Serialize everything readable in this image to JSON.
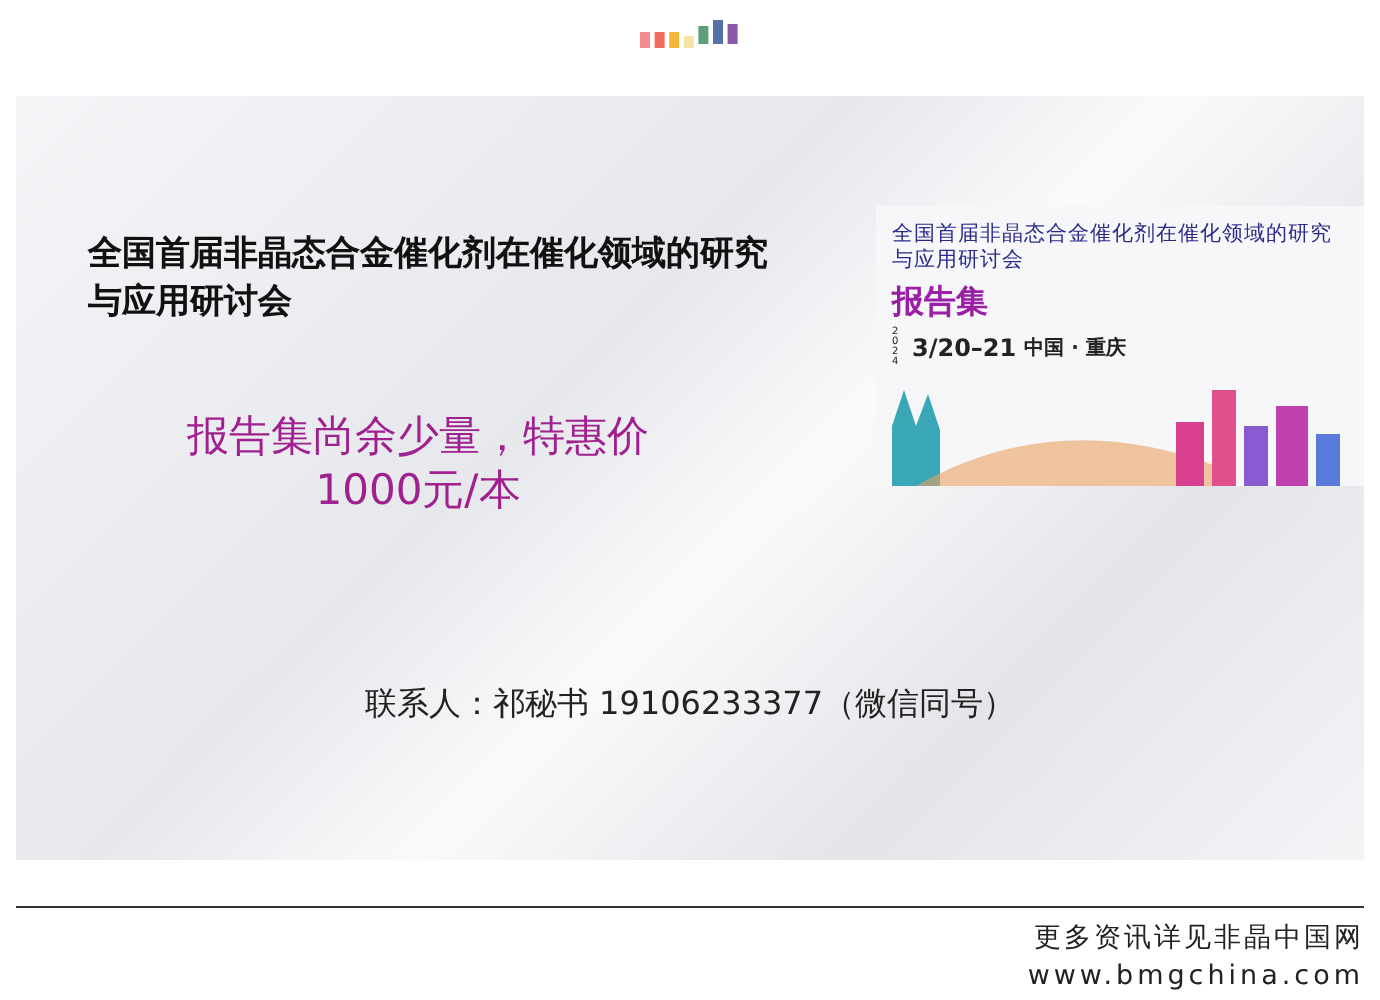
{
  "banner": {
    "title": "全国首届非晶态合金催化剂在催化领域的研究与应用研讨会",
    "promo_lines": [
      "报告集尚余少量，特惠价",
      "1000元/本"
    ],
    "contact": "联系人：祁秘书 19106233377（微信同号）",
    "cover": {
      "title": "全国首届非晶态合金催化剂在催化领域的研究与应用研讨会",
      "heading": "报告集",
      "year": "2024",
      "dates": "3/20–21",
      "place": "中国 · 重庆"
    }
  },
  "footer": {
    "line_1": "更多资讯详见非晶中国网",
    "line_2": "www.bmgchina.com"
  }
}
